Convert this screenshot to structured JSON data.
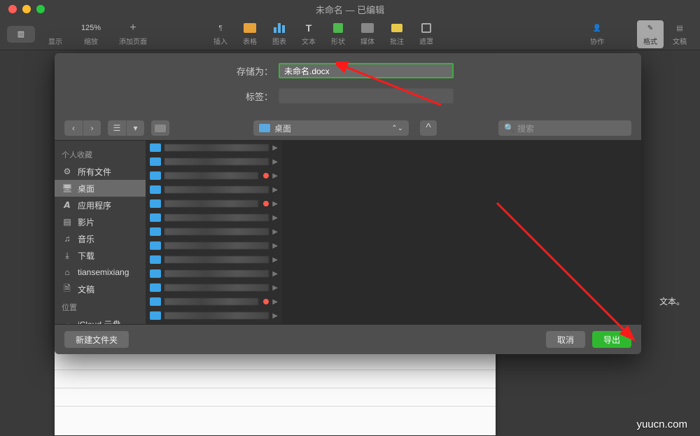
{
  "window": {
    "title": "未命名 — 已编辑"
  },
  "toolbar": {
    "view": "显示",
    "zoom": "缩放",
    "zoom_value": "125%",
    "add_page": "添加页面",
    "insert": "插入",
    "table": "表格",
    "chart": "图表",
    "text": "文本",
    "shape": "形状",
    "media": "媒体",
    "comment": "批注",
    "mask": "遮罩",
    "collaborate": "协作",
    "format": "格式",
    "document": "文稿"
  },
  "dialog": {
    "save_as_label": "存储为：",
    "filename": "未命名.docx",
    "tags_label": "标签：",
    "tags_value": "",
    "location": "桌面",
    "search_placeholder": "搜索",
    "new_folder": "新建文件夹",
    "cancel": "取消",
    "export": "导出"
  },
  "sidebar": {
    "favorites_header": "个人收藏",
    "items": [
      {
        "label": "所有文件",
        "icon": "gear"
      },
      {
        "label": "桌面",
        "icon": "desktop",
        "selected": true
      },
      {
        "label": "应用程序",
        "icon": "apps"
      },
      {
        "label": "影片",
        "icon": "film"
      },
      {
        "label": "音乐",
        "icon": "music"
      },
      {
        "label": "下载",
        "icon": "download"
      },
      {
        "label": "tiansemixiang",
        "icon": "home"
      },
      {
        "label": "文稿",
        "icon": "doc"
      }
    ],
    "locations_header": "位置",
    "locations": [
      {
        "label": "iCloud 云盘",
        "icon": "cloud"
      }
    ]
  },
  "files": [
    {
      "dot": false
    },
    {
      "dot": false
    },
    {
      "dot": true
    },
    {
      "dot": false
    },
    {
      "dot": true
    },
    {
      "dot": false
    },
    {
      "dot": false
    },
    {
      "dot": false
    },
    {
      "dot": false
    },
    {
      "dot": false
    },
    {
      "dot": false
    },
    {
      "dot": true
    },
    {
      "dot": false
    },
    {
      "dot": false
    }
  ],
  "sidepanel_hint": "文本。",
  "watermark": "yuucn.com"
}
